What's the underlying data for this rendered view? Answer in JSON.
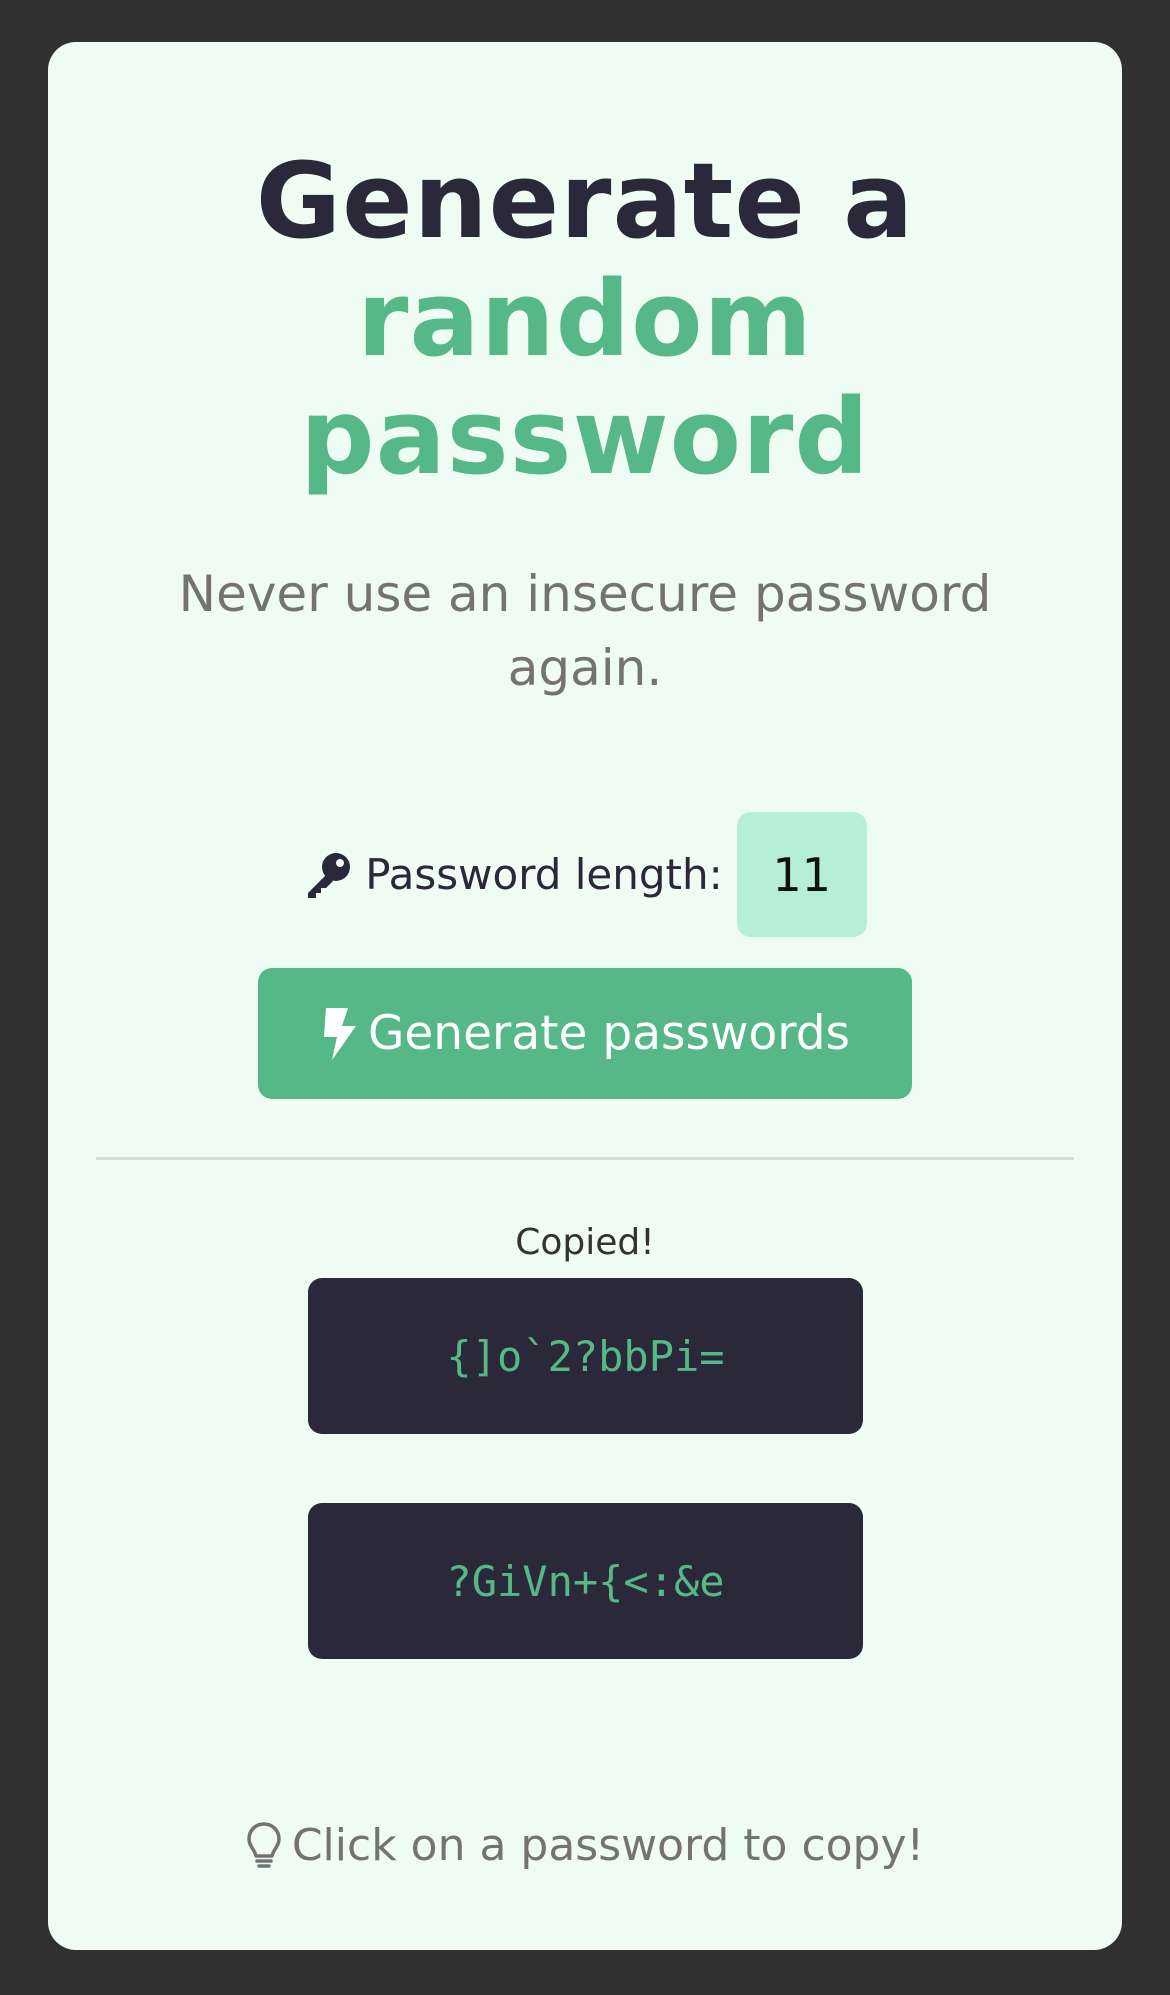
{
  "hero": {
    "title_line1": "Generate a",
    "title_line2": "random",
    "title_line3": "password",
    "subtitle": "Never use an insecure password again."
  },
  "length": {
    "icon": "key-icon",
    "label": "Password length:",
    "value": "11"
  },
  "generate": {
    "icon": "bolt-icon",
    "label": "Generate passwords"
  },
  "results": {
    "status": "Copied!",
    "passwords": [
      "{]o`2?bbPi=",
      "?GiVn+{<:&e"
    ]
  },
  "tip": {
    "icon": "lightbulb-icon",
    "text": "Click on a password to copy!"
  },
  "colors": {
    "background": "#303030",
    "card": "#effcf4",
    "dark": "#2a2839",
    "accent": "#55b886",
    "input": "#b4efd6",
    "muted": "#737373"
  }
}
